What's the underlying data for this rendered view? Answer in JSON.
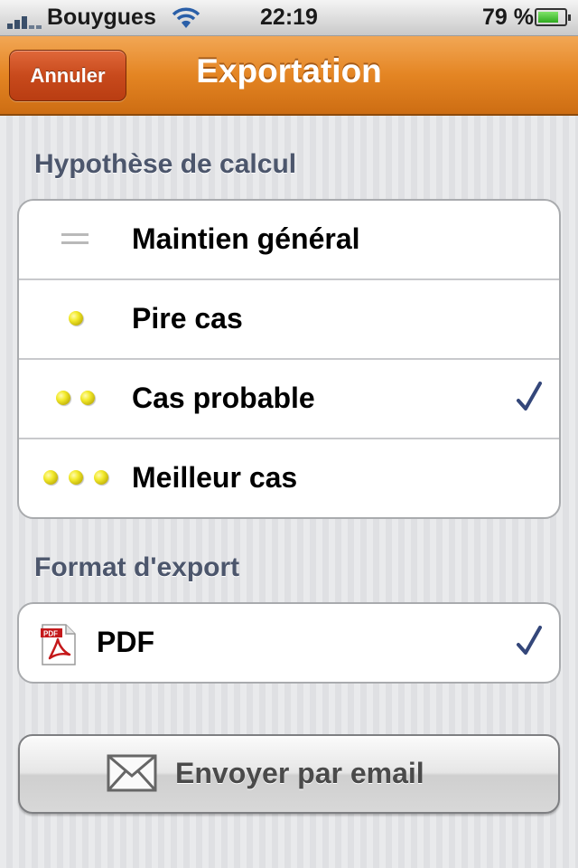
{
  "status_bar": {
    "carrier": "Bouygues",
    "time": "22:19",
    "battery_percent": "79 %",
    "battery_level": 0.79,
    "signal_icon": "signal-bars-icon",
    "wifi_icon": "wifi-icon"
  },
  "nav": {
    "title": "Exportation",
    "cancel_label": "Annuler",
    "accent_color": "#e48523"
  },
  "hypothesis": {
    "header": "Hypothèse de calcul",
    "items": [
      {
        "label": "Maintien général",
        "icon": "equals-icon",
        "selected": false
      },
      {
        "label": "Pire cas",
        "icon": "one-ball-icon",
        "selected": false
      },
      {
        "label": "Cas probable",
        "icon": "two-balls-icon",
        "selected": true
      },
      {
        "label": "Meilleur cas",
        "icon": "three-balls-icon",
        "selected": false
      }
    ]
  },
  "format": {
    "header": "Format d'export",
    "items": [
      {
        "label": "PDF",
        "icon": "pdf-icon",
        "selected": true
      }
    ]
  },
  "actions": {
    "email_label": "Envoyer par email",
    "email_icon": "envelope-icon"
  },
  "colors": {
    "checkmark": "#34477a",
    "section_header": "#4c566c"
  }
}
